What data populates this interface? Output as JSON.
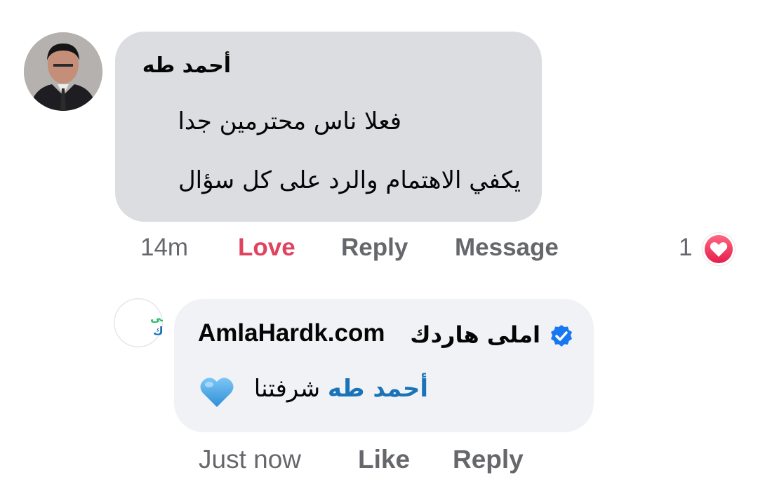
{
  "comments": [
    {
      "author": "أحمد طه",
      "lines": [
        "فعلا ناس محترمين جدا",
        "يكفي الاهتمام والرد على كل سؤال"
      ],
      "time": "14m",
      "reaction_label": "Love",
      "reply_label": "Reply",
      "message_label": "Message",
      "reaction_count": "1",
      "reaction_icon": "heart-reaction-icon"
    }
  ],
  "reply": {
    "author_latin": "AmlaHardk.com",
    "author_arabic": "املى هاردك",
    "verified_icon": "verified-badge-icon",
    "mention": "أحمد طه",
    "text": "شرفتنا",
    "emoji": "blue-heart-icon",
    "avatar_logo_text": [
      "املى",
      "هاردك"
    ],
    "time": "Just now",
    "like_label": "Like",
    "reply_label": "Reply"
  },
  "colors": {
    "love": "#e0435e",
    "mention": "#1a73b8",
    "verified": "#1877f2",
    "logo_green": "#2dbd6e",
    "logo_blue": "#1a73b8"
  }
}
